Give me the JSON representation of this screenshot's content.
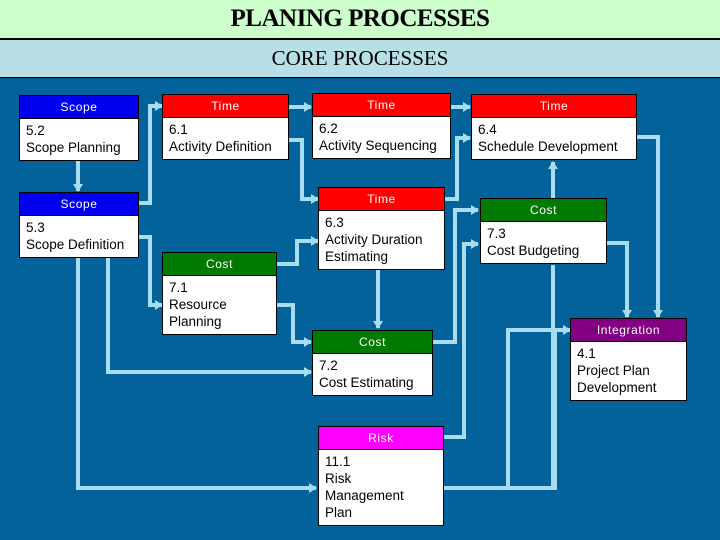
{
  "header": {
    "title": "PLANING PROCESSES",
    "subtitle": "CORE PROCESSES"
  },
  "colors": {
    "background": "#03629a",
    "connector": "#a8dcef",
    "scope": "#0000ee",
    "time": "#ff0000",
    "cost": "#007a00",
    "integration": "#800080",
    "risk": "#ff00ff"
  },
  "nodes": {
    "scope_planning": {
      "category": "Scope",
      "number": "5.2",
      "lines": [
        "Scope Planning"
      ]
    },
    "scope_definition": {
      "category": "Scope",
      "number": "5.3",
      "lines": [
        "Scope Definition"
      ]
    },
    "activity_definition": {
      "category": "Time",
      "number": "6.1",
      "lines": [
        "Activity Definition"
      ]
    },
    "activity_sequencing": {
      "category": "Time",
      "number": "6.2",
      "lines": [
        "Activity Sequencing"
      ]
    },
    "schedule_development": {
      "category": "Time",
      "number": "6.4",
      "lines": [
        "Schedule Development"
      ]
    },
    "activity_duration_estimating": {
      "category": "Time",
      "number": "6.3",
      "lines": [
        "Activity Duration",
        "Estimating"
      ]
    },
    "cost_budgeting": {
      "category": "Cost",
      "number": "7.3",
      "lines": [
        "Cost Budgeting"
      ]
    },
    "resource_planning": {
      "category": "Cost",
      "number": "7.1",
      "lines": [
        "Resource",
        "Planning"
      ]
    },
    "cost_estimating": {
      "category": "Cost",
      "number": "7.2",
      "lines": [
        "Cost Estimating"
      ]
    },
    "project_plan_development": {
      "category": "Integration",
      "number": "4.1",
      "lines": [
        "Project Plan",
        "Development"
      ]
    },
    "risk_management_plan": {
      "category": "Risk",
      "number": "11.1",
      "lines": [
        "Risk",
        "Management",
        "Plan"
      ]
    }
  },
  "edges": [
    {
      "from": "5.2",
      "to": "5.3"
    },
    {
      "from": "5.3",
      "to": "6.1"
    },
    {
      "from": "5.3",
      "to": "7.1"
    },
    {
      "from": "5.3",
      "to": "7.2"
    },
    {
      "from": "5.3",
      "to": "11.1"
    },
    {
      "from": "6.1",
      "to": "6.2"
    },
    {
      "from": "6.1",
      "to": "6.3"
    },
    {
      "from": "6.2",
      "to": "6.4"
    },
    {
      "from": "6.3",
      "to": "6.4"
    },
    {
      "from": "6.3",
      "to": "7.2"
    },
    {
      "from": "7.1",
      "to": "6.3"
    },
    {
      "from": "7.1",
      "to": "7.2"
    },
    {
      "from": "7.2",
      "to": "7.3"
    },
    {
      "from": "7.3",
      "to": "6.4"
    },
    {
      "from": "7.3",
      "to": "4.1"
    },
    {
      "from": "6.4",
      "to": "4.1"
    },
    {
      "from": "11.1",
      "to": "7.3"
    },
    {
      "from": "11.1",
      "to": "4.1"
    }
  ]
}
